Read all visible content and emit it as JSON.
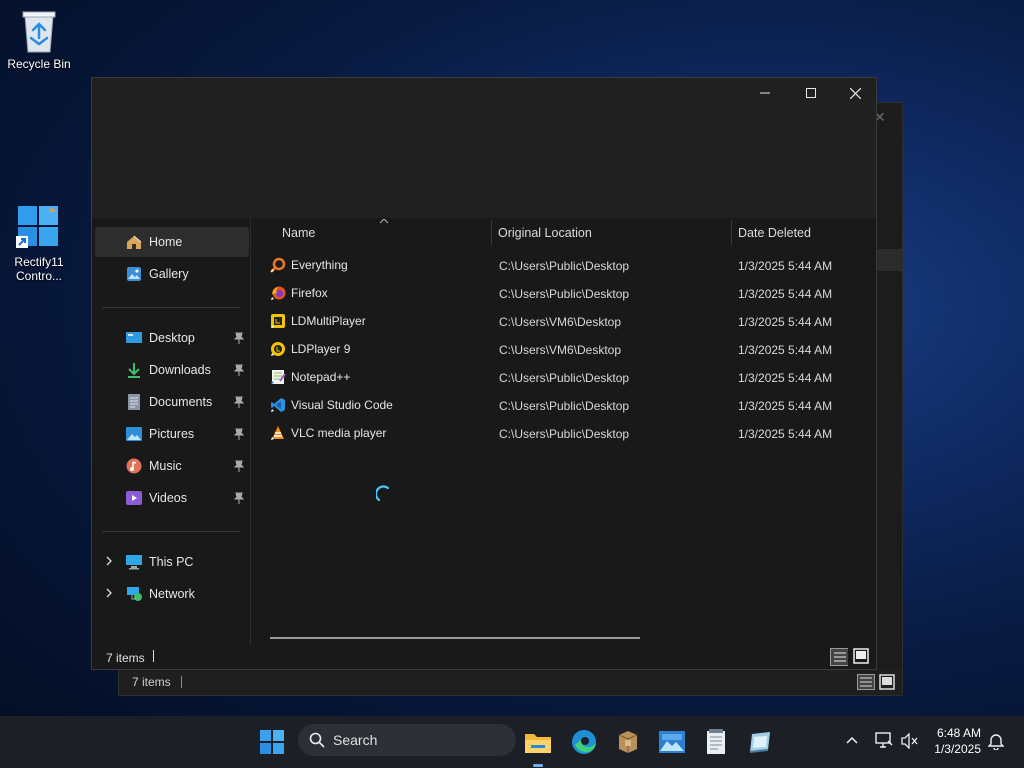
{
  "desktop": {
    "icons": [
      {
        "label": "Recycle Bin"
      },
      {
        "label": "Rectify11 Contro..."
      }
    ]
  },
  "back_window": {
    "status_text": "7 items"
  },
  "window": {
    "caption_buttons": [
      "minimize-icon",
      "maximize-icon",
      "close-icon"
    ],
    "sidebar": {
      "items": [
        {
          "label": "Home",
          "icon": "home-icon",
          "selected": true
        },
        {
          "label": "Gallery",
          "icon": "gallery-icon"
        },
        {
          "label": "Desktop",
          "icon": "desktop-folder-icon",
          "pinned": true
        },
        {
          "label": "Downloads",
          "icon": "download-icon",
          "pinned": true
        },
        {
          "label": "Documents",
          "icon": "documents-icon",
          "pinned": true
        },
        {
          "label": "Pictures",
          "icon": "pictures-icon",
          "pinned": true
        },
        {
          "label": "Music",
          "icon": "music-icon",
          "pinned": true
        },
        {
          "label": "Videos",
          "icon": "videos-icon",
          "pinned": true
        },
        {
          "label": "This PC",
          "icon": "this-pc-icon"
        },
        {
          "label": "Network",
          "icon": "network-icon"
        }
      ]
    },
    "columns": [
      "Name",
      "Original Location",
      "Date Deleted"
    ],
    "rows": [
      {
        "name": "Everything",
        "location": "C:\\Users\\Public\\Desktop",
        "date": "1/3/2025 5:44 AM"
      },
      {
        "name": "Firefox",
        "location": "C:\\Users\\Public\\Desktop",
        "date": "1/3/2025 5:44 AM"
      },
      {
        "name": "LDMultiPlayer",
        "location": "C:\\Users\\VM6\\Desktop",
        "date": "1/3/2025 5:44 AM"
      },
      {
        "name": "LDPlayer 9",
        "location": "C:\\Users\\VM6\\Desktop",
        "date": "1/3/2025 5:44 AM"
      },
      {
        "name": "Notepad++",
        "location": "C:\\Users\\Public\\Desktop",
        "date": "1/3/2025 5:44 AM"
      },
      {
        "name": "Visual Studio Code",
        "location": "C:\\Users\\Public\\Desktop",
        "date": "1/3/2025 5:44 AM"
      },
      {
        "name": "VLC media player",
        "location": "C:\\Users\\Public\\Desktop",
        "date": "1/3/2025 5:44 AM"
      }
    ],
    "status_text": "7 items"
  },
  "taskbar": {
    "search_label": "Search",
    "time": "6:48 AM",
    "date": "1/3/2025",
    "apps": [
      "start-icon",
      "file-explorer-icon",
      "edge-icon",
      "package-icon",
      "photos-icon",
      "notepad-icon",
      "installer-icon"
    ],
    "tray": [
      "chevron-up-icon",
      "monitor-network-icon",
      "volume-muted-icon",
      "notification-bell-icon"
    ]
  },
  "colors": {
    "accent": "#4cc2ff",
    "window_bg": "#191919",
    "titlebar_bg": "#202020"
  }
}
